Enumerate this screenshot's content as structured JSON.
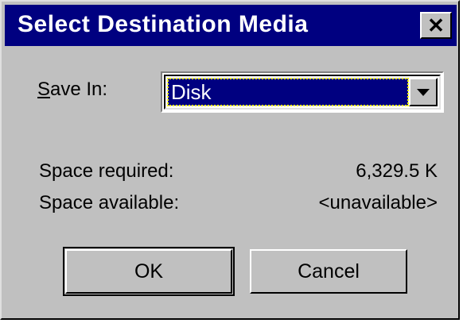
{
  "window": {
    "title": "Select Destination Media",
    "close_glyph": "✕"
  },
  "save_in": {
    "label_accesskey": "S",
    "label_rest": "ave In:",
    "selected": "Disk",
    "dropdown_icon": "chevron-down-icon"
  },
  "info": {
    "space_required_label": "Space required:",
    "space_required_value": "6,329.5 K",
    "space_available_label": "Space available:",
    "space_available_value": "<unavailable>"
  },
  "buttons": {
    "ok_label": "OK",
    "cancel_label": "Cancel"
  },
  "colors": {
    "titlebar": "#000080",
    "face": "#c0c0c0",
    "selection": "#000080"
  }
}
